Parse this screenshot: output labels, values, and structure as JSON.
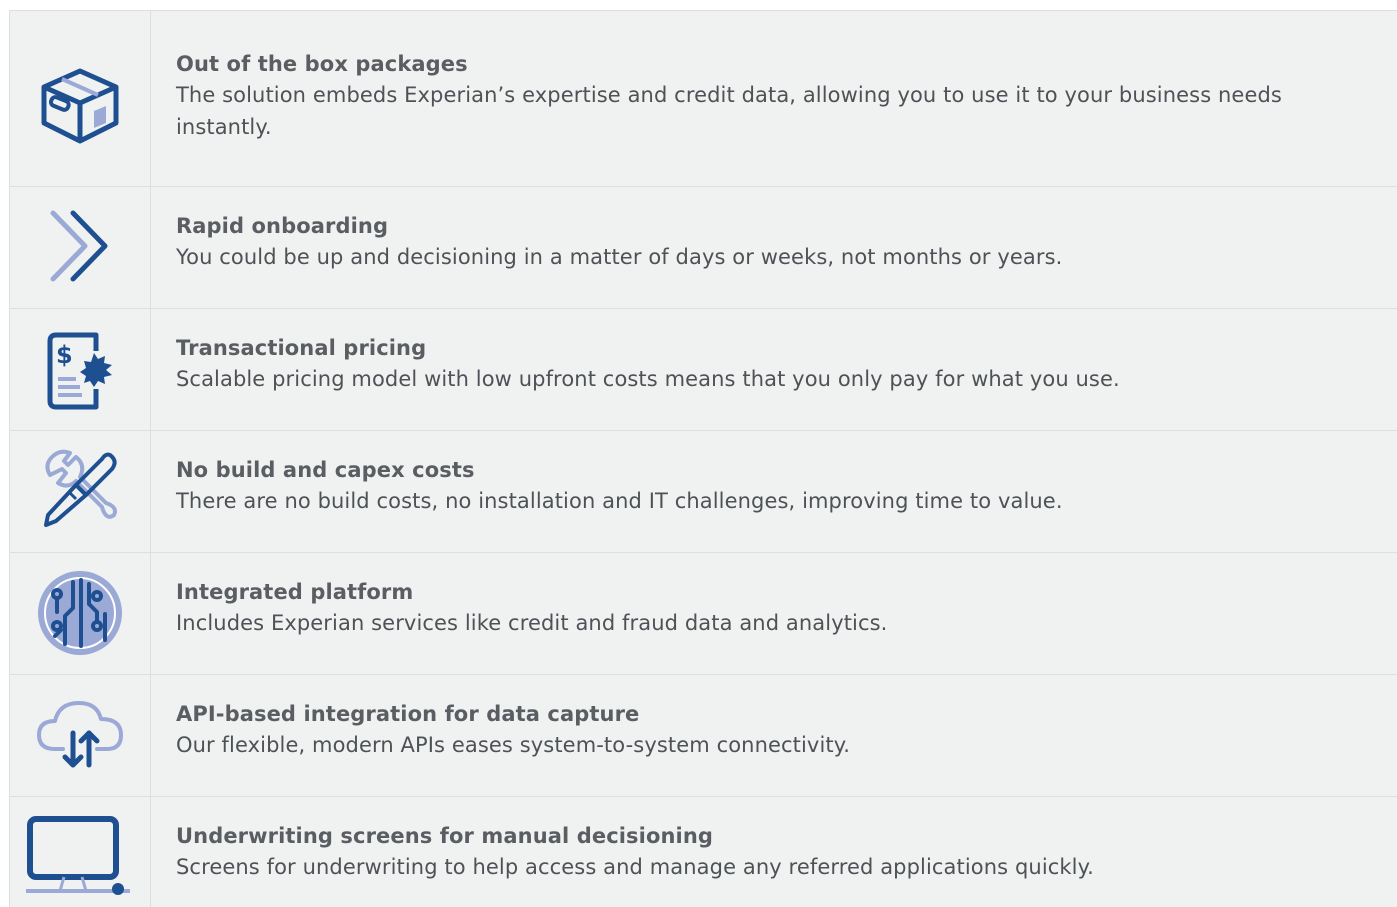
{
  "features": [
    {
      "icon": "package-box-icon",
      "title": "Out of the box packages",
      "description": "The solution embeds Experian’s expertise and credit data, allowing you to use it to your business needs instantly."
    },
    {
      "icon": "double-chevron-icon",
      "title": "Rapid onboarding",
      "description": "You could be up and decisioning in a matter of days or weeks, not months or years."
    },
    {
      "icon": "pricing-document-icon",
      "title": "Transactional pricing",
      "description": "Scalable pricing model with low upfront costs means that you only pay for what you use."
    },
    {
      "icon": "tools-icon",
      "title": "No build and capex costs",
      "description": "There are no build costs, no installation and IT challenges, improving time to value."
    },
    {
      "icon": "circuit-platform-icon",
      "title": "Integrated platform",
      "description": "Includes Experian services like credit and fraud data and analytics."
    },
    {
      "icon": "cloud-transfer-icon",
      "title": "API-based integration for data capture",
      "description": "Our flexible, modern APIs eases system-to-system connectivity."
    },
    {
      "icon": "monitor-icon",
      "title": "Underwriting screens for manual decisioning",
      "description": "Screens for underwriting to help access and manage any referred applications quickly."
    }
  ],
  "colors": {
    "icon_dark": "#1d4f91",
    "icon_light": "#9aa9d6",
    "background": "#f0f1f1",
    "divider": "#dcdedf"
  }
}
